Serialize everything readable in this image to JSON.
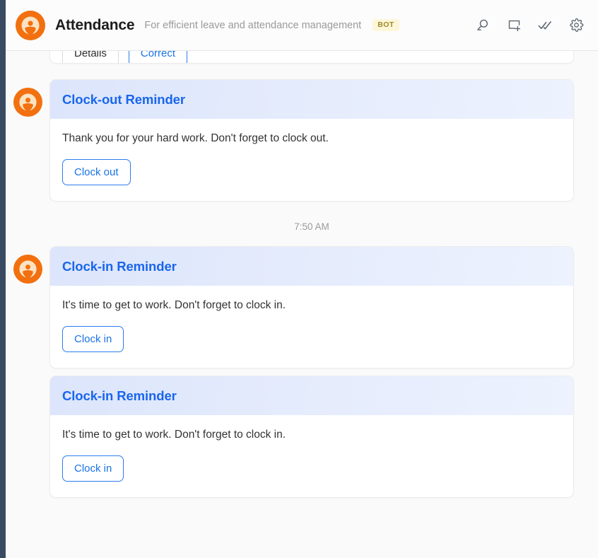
{
  "header": {
    "logo_icon": "attendance-person-logo",
    "title": "Attendance",
    "subtitle": "For efficient leave and attendance management",
    "badge": "BOT",
    "actions": [
      {
        "name": "search-icon",
        "label": "Search"
      },
      {
        "name": "new-chat-icon",
        "label": "New chat"
      },
      {
        "name": "mark-all-read-icon",
        "label": "Mark all read"
      },
      {
        "name": "gear-icon",
        "label": "Settings"
      }
    ]
  },
  "colors": {
    "brand_orange": "#f2700f",
    "accent_blue": "#1966ec",
    "rail_navy": "#3a4a63",
    "badge_bg": "#fdf6d8",
    "badge_text": "#a08a2a",
    "background": "#fafafa"
  },
  "partial_card": {
    "details_label": "Details",
    "correct_label": "Correct"
  },
  "timestamp": "7:50 AM",
  "messages": [
    {
      "show_avatar": true,
      "title": "Clock-out Reminder",
      "text": "Thank you for your hard work. Don't forget to clock out.",
      "button": "Clock out"
    },
    {
      "show_avatar": true,
      "title": "Clock-in Reminder",
      "text": "It's time to get to work. Don't forget to clock in.",
      "button": "Clock in"
    },
    {
      "show_avatar": false,
      "title": "Clock-in Reminder",
      "text": "It's time to get to work. Don't forget to clock in.",
      "button": "Clock in"
    }
  ]
}
